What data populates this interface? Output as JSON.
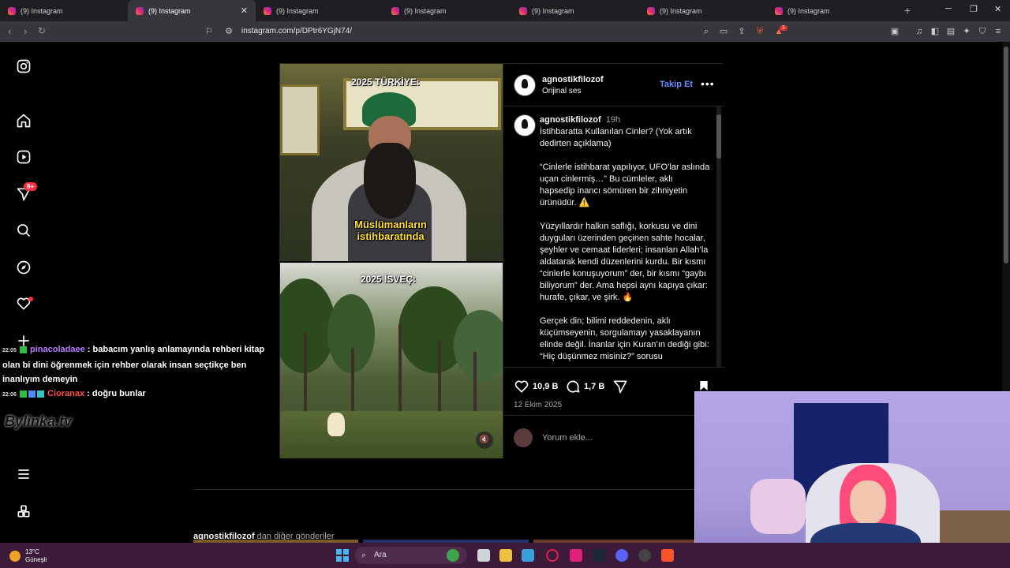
{
  "browser": {
    "tabs": [
      {
        "title": "(9) Instagram",
        "active": false
      },
      {
        "title": "(9) Instagram",
        "active": true
      },
      {
        "title": "(9) Instagram",
        "active": false
      },
      {
        "title": "(9) Instagram",
        "active": false
      },
      {
        "title": "(9) Instagram",
        "active": false
      },
      {
        "title": "(9) Instagram",
        "active": false
      },
      {
        "title": "(9) Instagram",
        "active": false
      }
    ],
    "close_glyph": "✕",
    "new_tab_glyph": "+",
    "url": "instagram.com/p/DPtr6YGjN74/",
    "brave_badge": "1"
  },
  "sidebar": {
    "notification_badge": "9+",
    "icons": [
      "instagram-logo-icon",
      "home-icon",
      "reels-icon",
      "messages-icon",
      "search-icon",
      "explore-icon",
      "notifications-icon",
      "create-icon",
      "more-icon",
      "also-from-meta-icon"
    ]
  },
  "post": {
    "header": {
      "username": "agnostikfilozof",
      "audio": "Orijinal ses",
      "follow_label": "Takip Et",
      "more": "•••"
    },
    "media": {
      "caption_top": "2025 TÜRKİYE:",
      "caption_middle_1": "Müslümanların",
      "caption_middle_2": "istihbaratında",
      "caption_bottom": "2025 İSVEÇ:"
    },
    "caption": {
      "username": "agnostikfilozof",
      "time": "19h",
      "p1": "İstihbaratta Kullanılan Cinler? (Yok artık dedirten açıklama)",
      "p2": "“Cinlerle istihbarat yapılıyor, UFO’lar aslında uçan cinlermiş…” Bu cümleler, aklı hapsedip inancı sömüren bir zihniyetin ürünüdür. ⚠️",
      "p3": "Yüzyıllardır halkın saflığı, korkusu ve dini duyguları üzerinden geçinen sahte hocalar, şeyhler ve cemaat liderleri; insanları Allah’la aldatarak kendi düzenlerini kurdu. Bir kısmı “cinlerle konuşuyorum” der, bir kısmı “gaybı biliyorum” der. Ama hepsi aynı kapıya çıkar: hurafe, çıkar, ve şirk. 🔥",
      "p4": "Gerçek din; bilimi reddedenin, aklı küçümseyenin, sorgulamayı yasaklayanın elinde değil. İnanlar için Kuran’ın dediği gibi: “Hiç düşünmez misiniz?” sorusu"
    },
    "likes": "10,9 B",
    "comments": "1,7 B",
    "date": "12 Ekim 2025",
    "comment_placeholder": "Yorum ekle..."
  },
  "more_posts": {
    "username": "agnostikfilozof",
    "suffix": " dan diğer gönderiler"
  },
  "chat": {
    "messages": [
      {
        "time": "22:05",
        "user": "pinacoladaee",
        "text": " : babacım yanlış anlamayında rehberi kitap olan bi dini öğrenmek için rehber olarak insan seçtikçe ben inanlıyım demeyin"
      },
      {
        "time": "22:06",
        "user": "Cioranax",
        "text": " : doğru bunlar"
      }
    ],
    "logo_text": "Bylinka.tv"
  },
  "taskbar": {
    "temperature": "13°C",
    "weather": "Güneşli",
    "search_label": "Ara"
  },
  "colors": {
    "accent_link": "#6c8dff",
    "badge_red": "#ff3040",
    "taskbar": "#3b1a3a"
  }
}
